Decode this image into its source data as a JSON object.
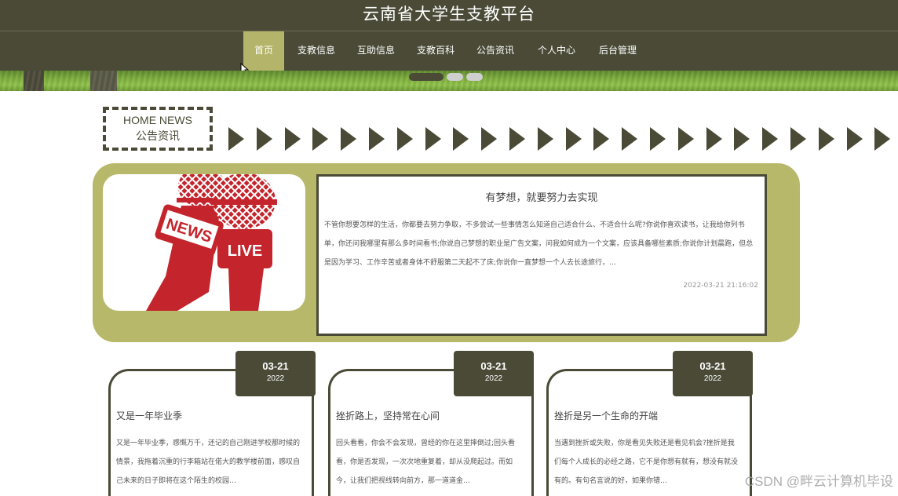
{
  "header": {
    "title": "云南省大学生支教平台"
  },
  "nav": {
    "items": [
      {
        "label": "首页",
        "active": true
      },
      {
        "label": "支教信息"
      },
      {
        "label": "互助信息"
      },
      {
        "label": "支教百科"
      },
      {
        "label": "公告资讯"
      },
      {
        "label": "个人中心"
      },
      {
        "label": "后台管理"
      }
    ]
  },
  "section": {
    "title_en": "HOME NEWS",
    "title_cn": "公告资讯"
  },
  "featured": {
    "image_text": {
      "news": "NEWS",
      "live": "LIVE"
    },
    "title": "有梦想，就要努力去实现",
    "body": "不管你想要怎样的生活，你都要去努力争取，不多尝试一些事情怎么知道自己适合什么、不适合什么呢?你说你喜欢读书，让我给你列书单，你还问我哪里有那么多时间看书;你说自己梦想的职业是广告文案，问我如何成为一个文案，应该具备哪些素质;你说你计划晨跑，但总是因为学习、工作辛苦或者身体不舒服第二天起不了床;你说你一直梦想一个人去长途旅行，…",
    "time": "2022-03-21 21:16:02"
  },
  "cards": [
    {
      "month_day": "03-21",
      "year": "2022",
      "title": "又是一年毕业季",
      "body": "又是一年毕业季，感慨万千，还记的自己刚进学校那时候的情景，我拖着沉重的行李箱站在偌大的教学楼前面，感叹自己未来的日子即将在这个陌生的校园…"
    },
    {
      "month_day": "03-21",
      "year": "2022",
      "title": "挫折路上，坚持常在心间",
      "body": "回头看看，你会不会发现，曾经的你在这里摔倒过;回头看看，你是否发现，一次次地重复着，却从没爬起过。而如今，让我们把视线转向前方，那一道道金…"
    },
    {
      "month_day": "03-21",
      "year": "2022",
      "title": "挫折是另一个生命的开端",
      "body": "当遇到挫折或失败，你是看见失败还是看见机会?挫折是我们每个人成长的必经之路，它不是你想有就有，想没有就没有的。有句名言说的好，如果你错…"
    }
  ],
  "watermark": "CSDN @畔云计算机毕设",
  "colors": {
    "primary": "#4a4a37",
    "accent": "#b8b86a",
    "nav_active": "#b4b46a"
  }
}
